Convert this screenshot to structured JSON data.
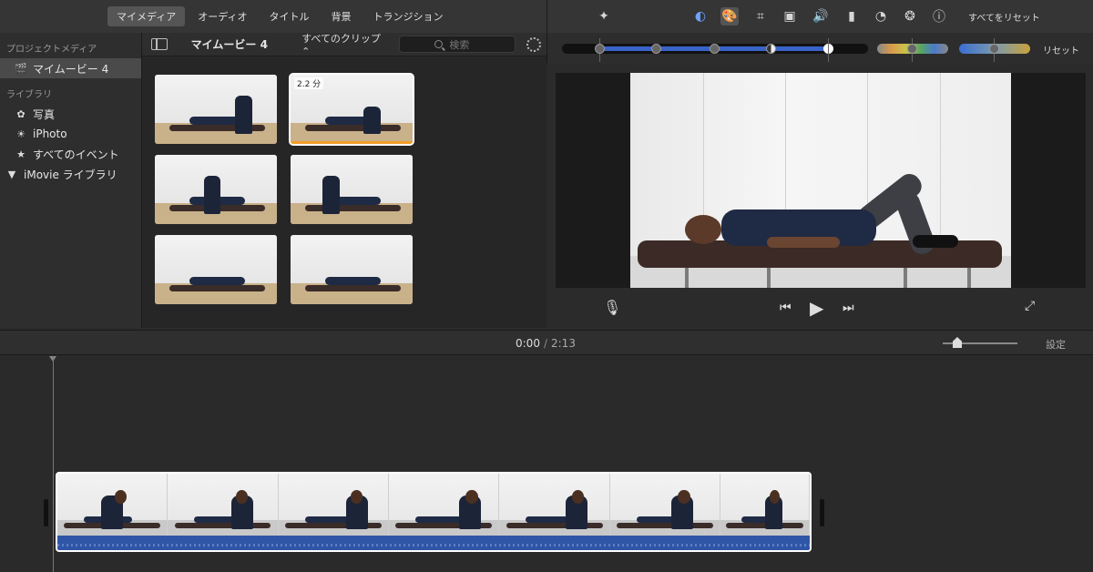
{
  "tabs": [
    {
      "label": "マイメディア",
      "active": true
    },
    {
      "label": "オーディオ",
      "active": false
    },
    {
      "label": "タイトル",
      "active": false
    },
    {
      "label": "背景",
      "active": false
    },
    {
      "label": "トランジション",
      "active": false
    }
  ],
  "sidebar": {
    "project_heading": "プロジェクトメディア",
    "project_item": "マイムービー 4",
    "library_heading": "ライブラリ",
    "items": [
      {
        "label": "写真",
        "icon": "photos-icon"
      },
      {
        "label": "iPhoto",
        "icon": "iphoto-icon"
      },
      {
        "label": "すべてのイベント",
        "icon": "star-icon"
      }
    ],
    "library_group": "iMovie ライブラリ"
  },
  "browser": {
    "project_title": "マイムービー 4",
    "clip_filter": "すべてのクリップ",
    "search_placeholder": "検索",
    "selected_duration": "2.2 分"
  },
  "inspector": {
    "reset_all": "すべてをリセット",
    "reset": "リセット",
    "icons": [
      "magic-wand-icon",
      "color-balance-icon",
      "color-correction-icon",
      "crop-icon",
      "stabilization-icon",
      "volume-icon",
      "equalizer-icon",
      "speed-icon",
      "filter-icon",
      "info-icon"
    ]
  },
  "timeline": {
    "current_time": "0:00",
    "separator": "/",
    "total_time": "2:13",
    "settings": "設定"
  },
  "colors": {
    "accent_blue": "#3a63c8",
    "selection_orange": "#f29e2b",
    "audio_blue": "#2f55a6"
  }
}
